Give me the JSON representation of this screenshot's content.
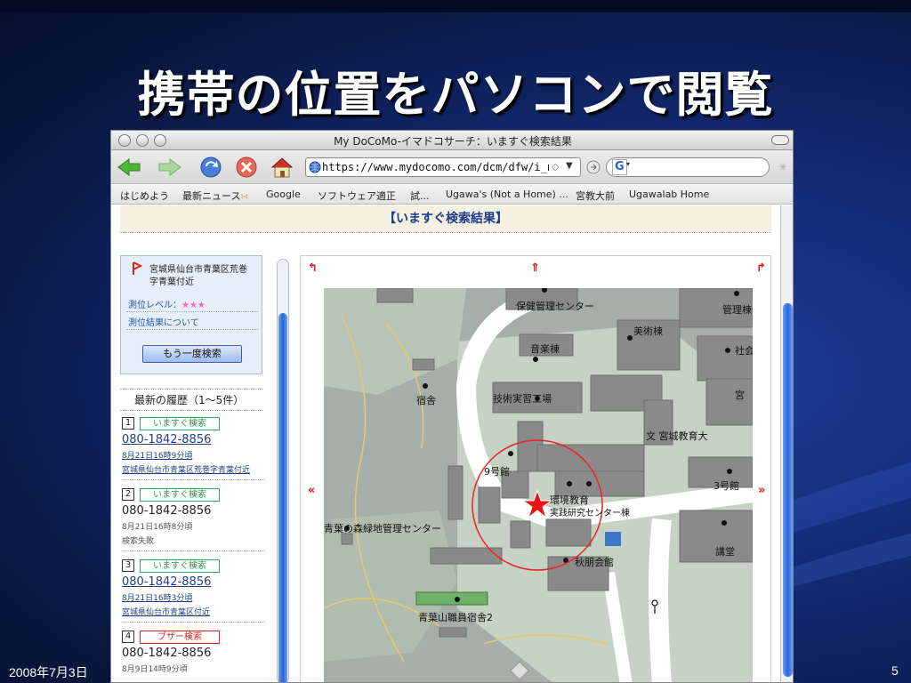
{
  "slide": {
    "title": "携帯の位置をパソコンで閲覧",
    "date": "2008年7月3日",
    "page_number": "5"
  },
  "browser": {
    "window_title": "My DoCoMo-イマドコサーチ：いますぐ検索結果",
    "url": "https://www.mydocomo.com/dcm/dfw/i_n",
    "search_engine_icon": "google-G-icon",
    "bookmarks": [
      "はじめよう",
      "最新ニュース",
      "Google",
      "ソフトウェア適正",
      "試...",
      "Ugawa's (Not a Home) ...",
      "宮教大前",
      "Ugawalab Home"
    ]
  },
  "page": {
    "header": "【いますぐ検索結果】",
    "location": {
      "address": "宮城県仙台市青葉区荒巻字青葉付近",
      "address_line1": "宮城県仙台市青葉区荒巻",
      "address_line2": "字青葉付近",
      "accuracy_label": "測位レベル：",
      "accuracy_stars": "★★★",
      "about_link": "測位結果について",
      "retry_button": "もう一度検索"
    },
    "history": {
      "title": "最新の履歴（1〜5件）",
      "items": [
        {
          "num": "1",
          "type": "いますぐ検索",
          "phone": "080-1842-8856",
          "date": "8月21日16時9分頃",
          "address": "宮城県仙台市青葉区荒巻字青葉付近"
        },
        {
          "num": "2",
          "type": "いますぐ検索",
          "phone": "080-1842-8856",
          "date": "8月21日16時8分頃",
          "address": "検索失敗"
        },
        {
          "num": "3",
          "type": "いますぐ検索",
          "phone": "080-1842-8856",
          "date": "8月21日16時3分頃",
          "address": "宮城県仙台市青葉区付近"
        },
        {
          "num": "4",
          "type": "ブザー検索",
          "phone": "080-1842-8856",
          "date": "8月9日14時9分頃",
          "address": ""
        }
      ]
    },
    "map": {
      "arrows": {
        "nw": "↰",
        "n": "⇑",
        "ne": "↱",
        "w": "«",
        "e": "»"
      },
      "labels": [
        "保健管理センター",
        "管理棟",
        "美術棟",
        "社会",
        "音楽棟",
        "宿舎",
        "技術実習工場",
        "宮",
        "文 宮城教育大",
        "9号館",
        "3号館",
        "環境教育",
        "実践研究センター棟",
        "青葉の森緑地管理センター",
        "講堂",
        "秋朋会館",
        "青葉山職員宿舎2"
      ]
    }
  }
}
